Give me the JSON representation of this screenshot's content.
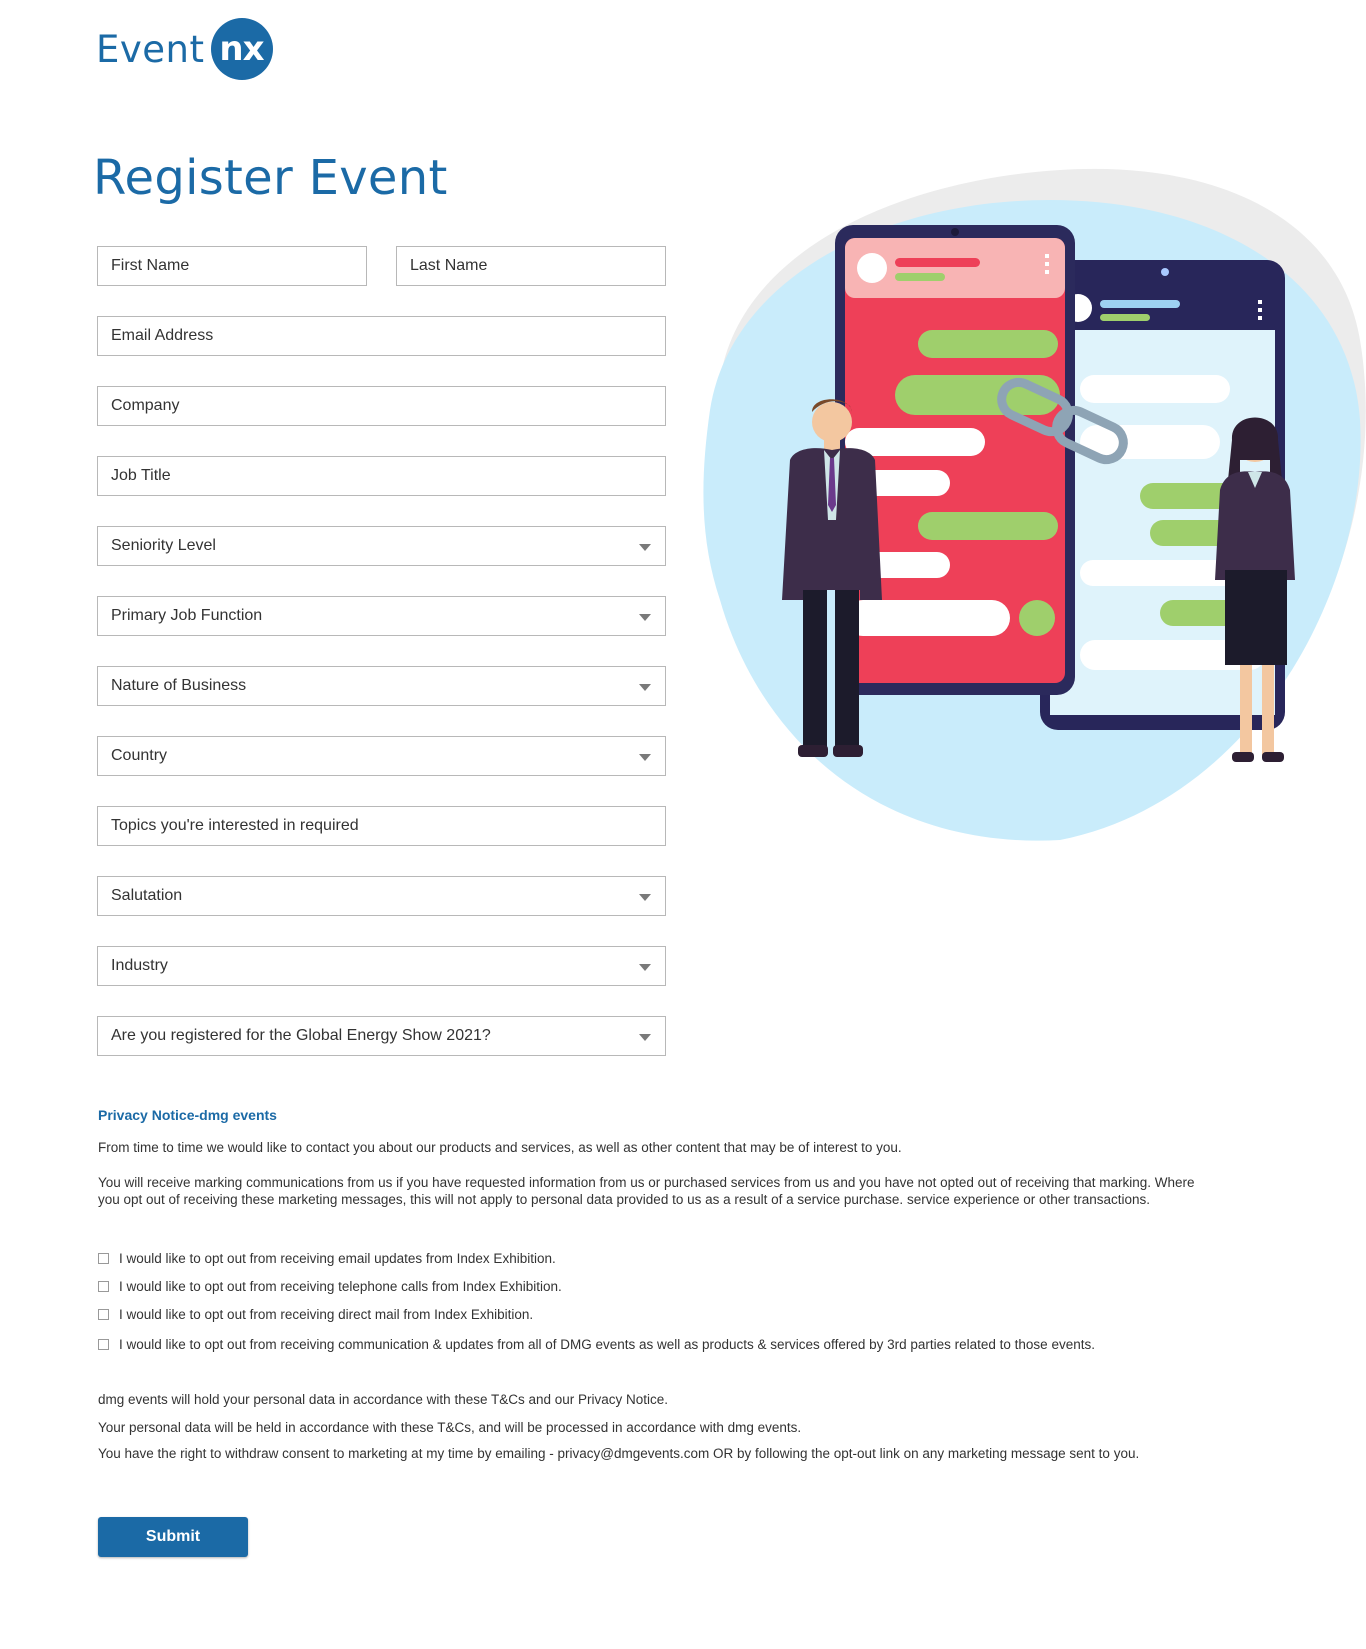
{
  "header": {
    "logo_text": "Event",
    "logo_badge": "nx"
  },
  "page": {
    "title": "Register Event"
  },
  "form": {
    "first_name": "First Name",
    "last_name": "Last Name",
    "email": "Email Address",
    "company": "Company",
    "job_title": "Job Title",
    "seniority": "Seniority Level",
    "job_function": "Primary Job Function",
    "nature_of_business": "Nature of Business",
    "country": "Country",
    "topics": "Topics you're interested in required",
    "salutation": "Salutation",
    "industry": "Industry",
    "registered_question": "Are you registered for the Global Energy Show 2021?"
  },
  "privacy": {
    "title": "Privacy Notice-dmg events",
    "intro": "From time to time we would like to contact you about our products and services, as well as other content that may be of interest to you.",
    "marketing": "You will receive marking communications from us if you have requested information from us or purchased services from us and you have not opted out of receiving that marking. Where you opt out of receiving these marketing messages, this will not apply to personal data provided to us as a result of a service purchase. service experience or other transactions.",
    "optouts": [
      "I would like to opt out from receiving email updates from Index Exhibition.",
      "I would like to opt out from receiving telephone calls from Index Exhibition.",
      "I would like to opt out from receiving direct mail from Index Exhibition.",
      "I would like to opt out from receiving communication & updates from all of DMG events as well as products & services offered by 3rd parties related to those events."
    ],
    "hold_data": "dmg events will hold your personal data in accordance with these T&Cs and our Privacy Notice.",
    "processed": "Your personal data will be held in accordance with these T&Cs, and will be processed in accordance with dmg events.",
    "withdraw": "You have the right to withdraw consent to marketing at my time by emailing - privacy@dmgevents.com OR by following the opt-out link on any  marketing message sent to you."
  },
  "actions": {
    "submit": "Submit"
  }
}
